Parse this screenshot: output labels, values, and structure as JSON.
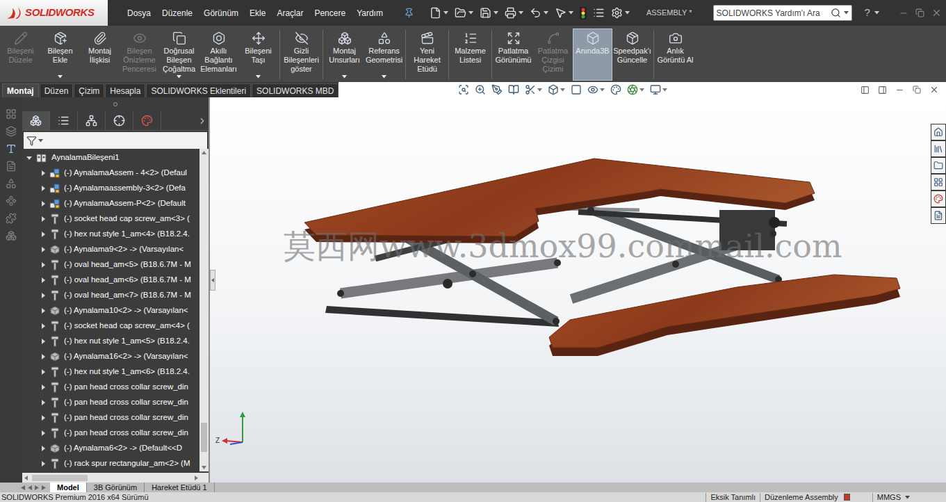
{
  "app": {
    "logo": "SOLIDWORKS",
    "document": "ASSEMBLY *",
    "help": "?"
  },
  "menu": [
    "Dosya",
    "Düzenle",
    "Görünüm",
    "Ekle",
    "Araçlar",
    "Pencere",
    "Yardım"
  ],
  "search": {
    "placeholder": "SOLIDWORKS Yardım'ı Ara"
  },
  "ribbon": [
    {
      "label": "Bileşeni Düzele",
      "disabled": true,
      "selected": false,
      "dropdown": false,
      "separator": false
    },
    {
      "label": "Bileşen Ekle",
      "disabled": false,
      "selected": false,
      "dropdown": true,
      "separator": false
    },
    {
      "label": "Montaj İlişkisi",
      "disabled": false,
      "selected": false,
      "dropdown": false,
      "separator": false
    },
    {
      "label": "Bileşen Önizleme Penceresi",
      "disabled": true,
      "selected": false,
      "dropdown": false,
      "separator": false
    },
    {
      "label": "Doğrusal Bileşen Çoğaltma",
      "disabled": false,
      "selected": false,
      "dropdown": true,
      "separator": false
    },
    {
      "label": "Akıllı Bağlantı Elemanları",
      "disabled": false,
      "selected": false,
      "dropdown": false,
      "separator": false
    },
    {
      "label": "Bileşeni Taşı",
      "disabled": false,
      "selected": false,
      "dropdown": true,
      "separator": true
    },
    {
      "label": "Gizli Bileşenleri göster",
      "disabled": false,
      "selected": false,
      "dropdown": false,
      "separator": true
    },
    {
      "label": "Montaj Unsurları",
      "disabled": false,
      "selected": false,
      "dropdown": true,
      "separator": false
    },
    {
      "label": "Referans Geometrisi",
      "disabled": false,
      "selected": false,
      "dropdown": true,
      "separator": true
    },
    {
      "label": "Yeni Hareket Etüdü",
      "disabled": false,
      "selected": false,
      "dropdown": false,
      "separator": true
    },
    {
      "label": "Malzeme Listesi",
      "disabled": false,
      "selected": false,
      "dropdown": false,
      "separator": true
    },
    {
      "label": "Patlatma Görünümü",
      "disabled": false,
      "selected": false,
      "dropdown": false,
      "separator": false
    },
    {
      "label": "Patlatma Çizgisi Çizimi",
      "disabled": true,
      "selected": false,
      "dropdown": false,
      "separator": false
    },
    {
      "label": "Anında3B",
      "disabled": false,
      "selected": true,
      "dropdown": false,
      "separator": false
    },
    {
      "label": "Speedpak'ı Güncelle",
      "disabled": false,
      "selected": false,
      "dropdown": false,
      "separator": true
    },
    {
      "label": "Anlık Görüntü Al",
      "disabled": false,
      "selected": false,
      "dropdown": false,
      "separator": false
    }
  ],
  "ribbon_tabs": [
    {
      "label": "Montaj",
      "selected": true
    },
    {
      "label": "Düzen",
      "selected": false
    },
    {
      "label": "Çizim",
      "selected": false
    },
    {
      "label": "Hesapla",
      "selected": false
    },
    {
      "label": "SOLIDWORKS Eklentileri",
      "selected": false
    },
    {
      "label": "SOLIDWORKS MBD",
      "selected": false
    }
  ],
  "tree": {
    "root": {
      "label": "AynalamaBileşeni1",
      "expanded": true
    },
    "items": [
      {
        "label": "(-) AynalamaAssem - 4<2> (Defaul",
        "kind": "assembly",
        "expanded": false
      },
      {
        "label": "(-) Aynalamaassembly-3<2> (Defa",
        "kind": "assembly",
        "expanded": false
      },
      {
        "label": "(-) AynalamaAssem-P<2> (Default",
        "kind": "assembly",
        "expanded": false
      },
      {
        "label": "(-) socket head cap screw_am<3> (",
        "kind": "fastener",
        "expanded": false
      },
      {
        "label": "(-) hex nut style 1_am<4> (B18.2.4.",
        "kind": "fastener",
        "expanded": false
      },
      {
        "label": "(-) Aynalama9<2> -> (Varsayılan<",
        "kind": "part",
        "expanded": false
      },
      {
        "label": "(-) oval head_am<5> (B18.6.7M - M",
        "kind": "fastener",
        "expanded": false
      },
      {
        "label": "(-) oval head_am<6> (B18.6.7M - M",
        "kind": "fastener",
        "expanded": false
      },
      {
        "label": "(-) oval head_am<7> (B18.6.7M - M",
        "kind": "fastener",
        "expanded": false
      },
      {
        "label": "(-) Aynalama10<2> -> (Varsayılan<",
        "kind": "part",
        "expanded": false
      },
      {
        "label": "(-) socket head cap screw_am<4> (",
        "kind": "fastener",
        "expanded": false
      },
      {
        "label": "(-) hex nut style 1_am<5> (B18.2.4.",
        "kind": "fastener",
        "expanded": false
      },
      {
        "label": "(-) Aynalama16<2> -> (Varsayılan<",
        "kind": "part",
        "expanded": false
      },
      {
        "label": "(-) hex nut style 1_am<6> (B18.2.4.",
        "kind": "fastener",
        "expanded": false
      },
      {
        "label": "(-) pan head cross collar screw_din",
        "kind": "fastener",
        "expanded": false
      },
      {
        "label": "(-) pan head cross collar screw_din",
        "kind": "fastener",
        "expanded": false
      },
      {
        "label": "(-) pan head cross collar screw_din",
        "kind": "fastener",
        "expanded": false
      },
      {
        "label": "(-) pan head cross collar screw_din",
        "kind": "fastener",
        "expanded": false
      },
      {
        "label": "(-) Aynalama6<2> -> (Default<<D",
        "kind": "part",
        "expanded": false
      },
      {
        "label": "(-) rack spur rectangular_am<2> (M",
        "kind": "fastener",
        "expanded": false
      }
    ]
  },
  "viewport": {
    "watermark": "莫西网www.3dmox99.commail.com",
    "triad_label": "Z"
  },
  "bottom_tabs": [
    {
      "label": "Model",
      "selected": true
    },
    {
      "label": "3B Görünüm",
      "selected": false
    },
    {
      "label": "Hareket Etüdü 1",
      "selected": false
    }
  ],
  "status_bar": {
    "version": "SOLIDWORKS Premium 2016 x64 Sürümü",
    "definition": "Eksik Tanımlı",
    "mode": "Düzenleme Assembly",
    "units": "MMGS"
  }
}
